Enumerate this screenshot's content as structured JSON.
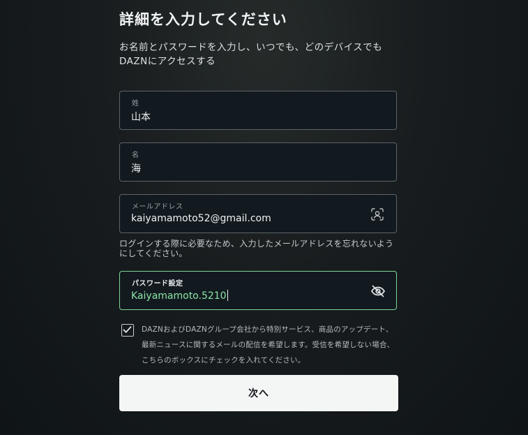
{
  "page": {
    "title": "詳細を入力してください",
    "subtitle": "お名前とパスワードを入力し、いつでも、どのデバイスでもDAZNにアクセスする"
  },
  "fields": {
    "last_name": {
      "label": "姓",
      "value": "山本"
    },
    "first_name": {
      "label": "名",
      "value": "海"
    },
    "email": {
      "label": "メールアドレス",
      "value": "kaiyamamoto52@gmail.com",
      "icon": "contact-autofill-icon",
      "hint": "ログインする際に必要なため、入力したメールアドレスを忘れないようにしてください。"
    },
    "password": {
      "label": "パスワード設定",
      "value": "Kaiyamamoto.5210",
      "icon": "eye-off-icon",
      "focused": true
    }
  },
  "consent": {
    "checked": true,
    "text": "DAZNおよびDAZNグループ会社から特別サービス、商品のアップデート、最新ニュースに関するメールの配信を希望します。受信を希望しない場合、こちらのボックスにチェックを入れてください。"
  },
  "actions": {
    "next_label": "次へ"
  },
  "colors": {
    "focus_border": "#7fd69a",
    "focus_text": "#8ce3a6",
    "button_bg": "#f4f6f6",
    "background": "#181c1e"
  }
}
